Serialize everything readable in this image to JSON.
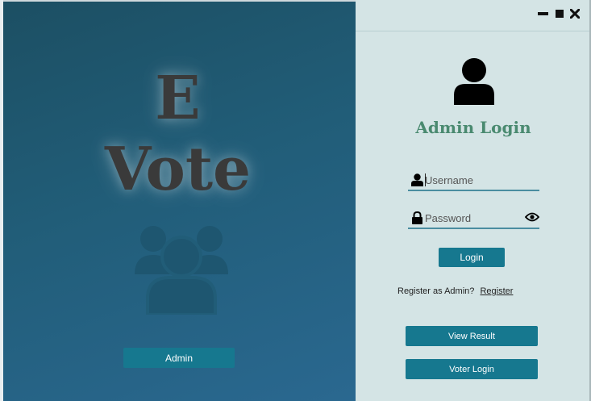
{
  "brand": {
    "line1": "E",
    "line2": "Vote"
  },
  "left_panel": {
    "admin_button": "Admin",
    "icon": "user-group-icon"
  },
  "window_controls": {
    "minimize": "minimize-icon",
    "maximize": "maximize-icon",
    "close": "close-icon"
  },
  "login_form": {
    "icon": "user-icon",
    "title": "Admin Login",
    "username_placeholder": "Username",
    "username_value": "",
    "password_placeholder": "Password",
    "password_value": "",
    "login_button": "Login",
    "register_prompt": "Register as Admin?",
    "register_link": "Register",
    "view_result_button": "View Result",
    "voter_login_button": "Voter Login"
  },
  "colors": {
    "button": "#16788f",
    "title_green": "#4a8a70",
    "right_bg": "#d4e4e5",
    "left_gradient_start": "#1c4f63",
    "left_gradient_end": "#2a6890"
  }
}
